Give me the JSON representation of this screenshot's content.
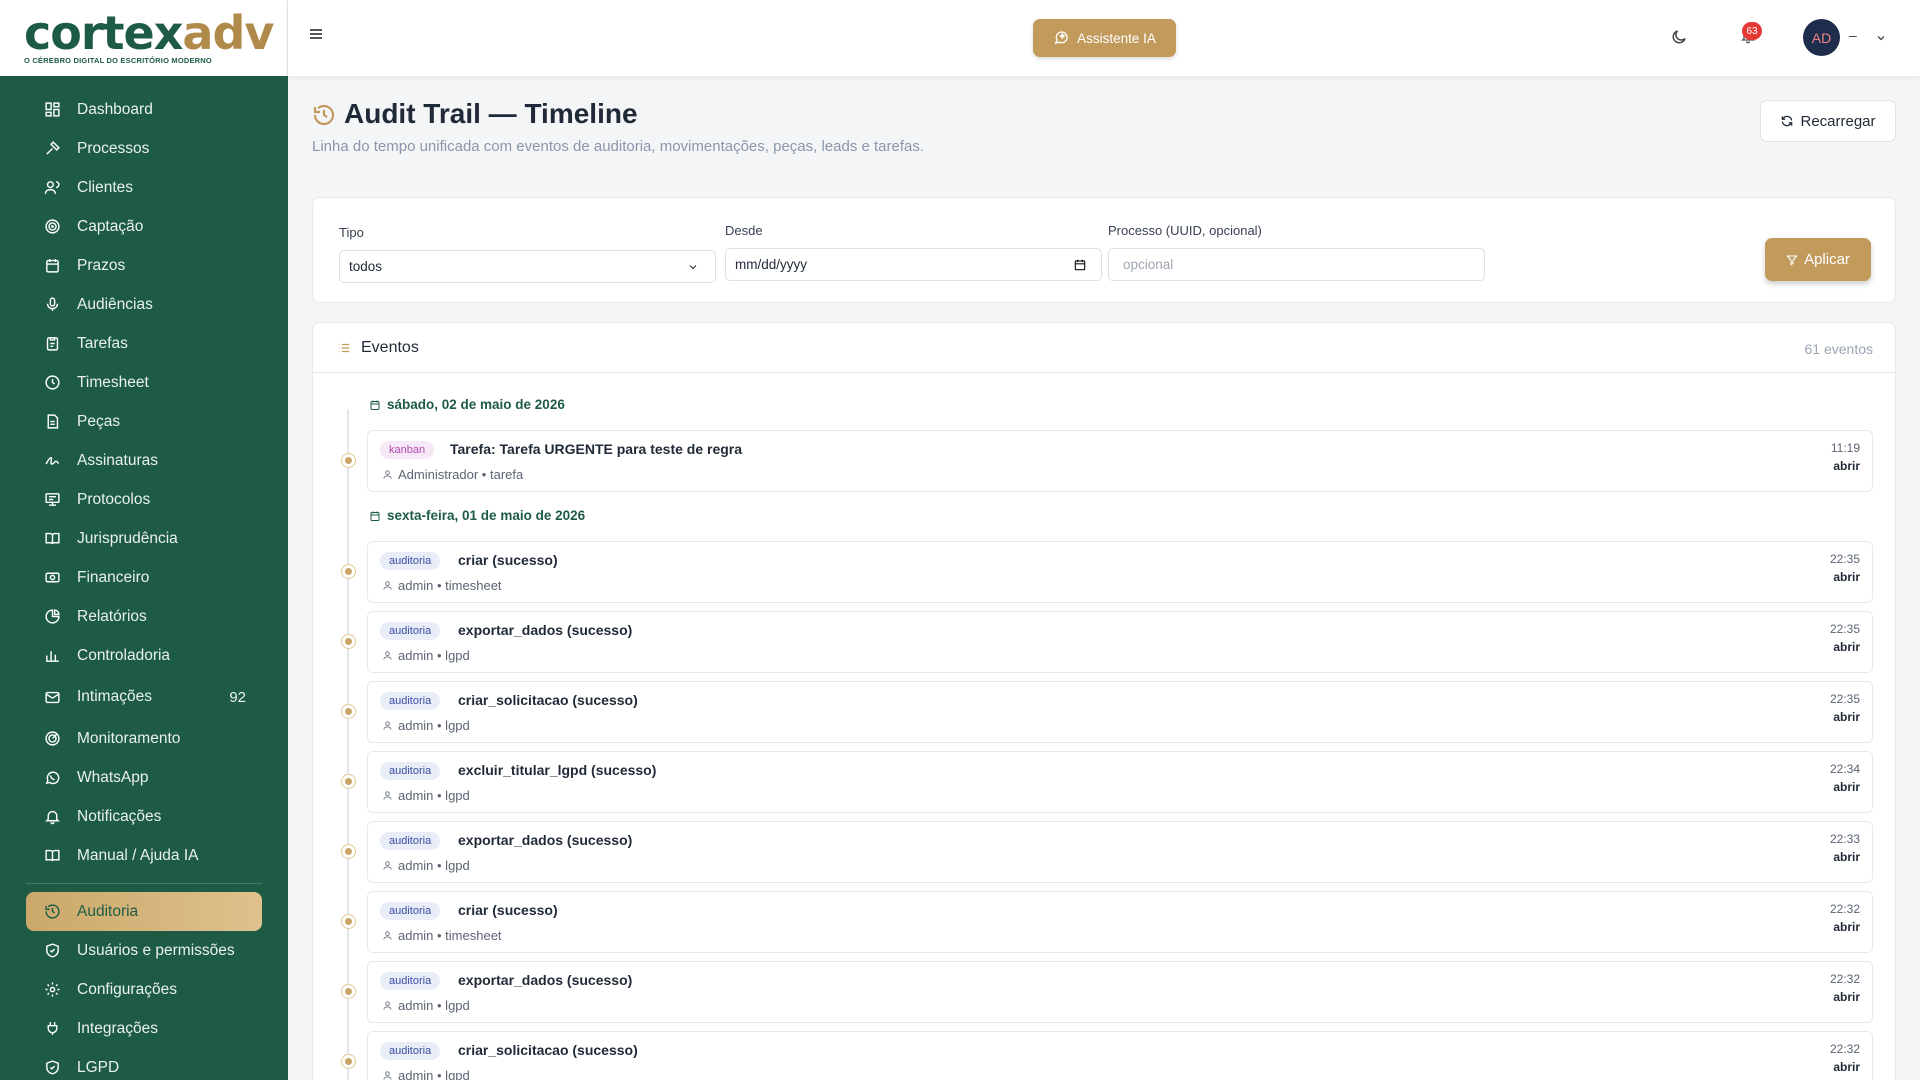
{
  "brand": {
    "name_part1": "cortex",
    "name_part2": "adv",
    "tagline": "O CÉREBRO DIGITAL DO ESCRITÓRIO MODERNO"
  },
  "sidebar": {
    "items": [
      {
        "label": "Dashboard",
        "icon": "dashboard-icon"
      },
      {
        "label": "Processos",
        "icon": "gavel-icon"
      },
      {
        "label": "Clientes",
        "icon": "users-icon"
      },
      {
        "label": "Captação",
        "icon": "target-icon"
      },
      {
        "label": "Prazos",
        "icon": "calendar-icon"
      },
      {
        "label": "Audiências",
        "icon": "microphone-icon"
      },
      {
        "label": "Tarefas",
        "icon": "clipboard-icon"
      },
      {
        "label": "Timesheet",
        "icon": "clock-icon"
      },
      {
        "label": "Peças",
        "icon": "document-icon"
      },
      {
        "label": "Assinaturas",
        "icon": "signature-icon"
      },
      {
        "label": "Protocolos",
        "icon": "protocol-icon"
      },
      {
        "label": "Jurisprudência",
        "icon": "book-icon"
      },
      {
        "label": "Financeiro",
        "icon": "money-icon"
      },
      {
        "label": "Relatórios",
        "icon": "pie-chart-icon"
      },
      {
        "label": "Controladoria",
        "icon": "bar-chart-icon"
      },
      {
        "label": "Intimações",
        "icon": "mail-icon",
        "count": "92"
      },
      {
        "label": "Monitoramento",
        "icon": "radar-icon"
      },
      {
        "label": "WhatsApp",
        "icon": "whatsapp-icon"
      },
      {
        "label": "Notificações",
        "icon": "bell-icon"
      },
      {
        "label": "Manual / Ajuda IA",
        "icon": "book-icon"
      }
    ],
    "admin_items": [
      {
        "label": "Auditoria",
        "icon": "history-icon",
        "active": true
      },
      {
        "label": "Usuários e permissões",
        "icon": "shield-icon"
      },
      {
        "label": "Configurações",
        "icon": "gear-icon"
      },
      {
        "label": "Integrações",
        "icon": "plug-icon"
      },
      {
        "label": "LGPD",
        "icon": "shield-icon"
      }
    ]
  },
  "topbar": {
    "ai_button": "Assistente IA",
    "notification_count": "63",
    "avatar_initials": "AD",
    "user_name": "–"
  },
  "page": {
    "title": "Audit Trail — Timeline",
    "subtitle": "Linha do tempo unificada com eventos de auditoria, movimentações, peças, leads e tarefas.",
    "reload_button": "Recarregar"
  },
  "filters": {
    "tipo_label": "Tipo",
    "tipo_value": "todos",
    "desde_label": "Desde",
    "desde_value": "mm/dd/yyyy",
    "processo_label": "Processo (UUID, opcional)",
    "processo_placeholder": "opcional",
    "apply_button": "Aplicar"
  },
  "events": {
    "title": "Eventos",
    "count": "61 eventos",
    "days": [
      {
        "date": "sábado, 02 de maio de 2026",
        "items": [
          {
            "tag": "kanban",
            "title": "Tarefa: Tarefa URGENTE para teste de regra",
            "meta": "Administrador • tarefa",
            "time": "11:19",
            "action": "abrir"
          }
        ]
      },
      {
        "date": "sexta-feira, 01 de maio de 2026",
        "items": [
          {
            "tag": "auditoria",
            "title": "criar (sucesso)",
            "meta": "admin • timesheet",
            "time": "22:35",
            "action": "abrir"
          },
          {
            "tag": "auditoria",
            "title": "exportar_dados (sucesso)",
            "meta": "admin • lgpd",
            "time": "22:35",
            "action": "abrir"
          },
          {
            "tag": "auditoria",
            "title": "criar_solicitacao (sucesso)",
            "meta": "admin • lgpd",
            "time": "22:35",
            "action": "abrir"
          },
          {
            "tag": "auditoria",
            "title": "excluir_titular_lgpd (sucesso)",
            "meta": "admin • lgpd",
            "time": "22:34",
            "action": "abrir"
          },
          {
            "tag": "auditoria",
            "title": "exportar_dados (sucesso)",
            "meta": "admin • lgpd",
            "time": "22:33",
            "action": "abrir"
          },
          {
            "tag": "auditoria",
            "title": "criar (sucesso)",
            "meta": "admin • timesheet",
            "time": "22:32",
            "action": "abrir"
          },
          {
            "tag": "auditoria",
            "title": "exportar_dados (sucesso)",
            "meta": "admin • lgpd",
            "time": "22:32",
            "action": "abrir"
          },
          {
            "tag": "auditoria",
            "title": "criar_solicitacao (sucesso)",
            "meta": "admin • lgpd",
            "time": "22:32",
            "action": "abrir"
          }
        ]
      }
    ]
  },
  "colors": {
    "sidebar": "#1e5b45",
    "accent_gold": "#c29a5c",
    "badge_red": "#e53935"
  }
}
